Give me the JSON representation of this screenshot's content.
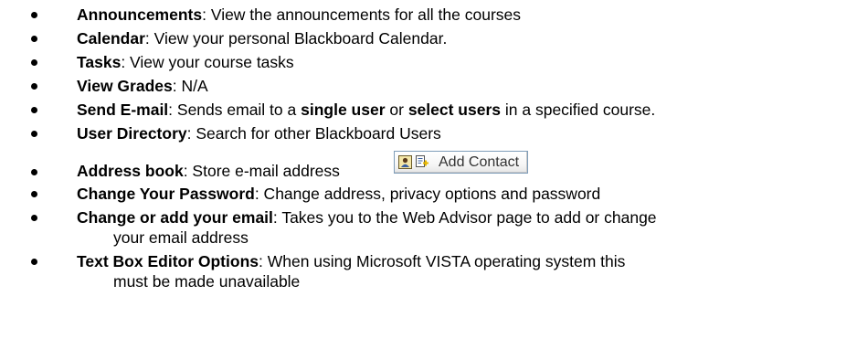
{
  "items": [
    {
      "term": "Announcements",
      "desc": ": View the announcements for all the courses"
    },
    {
      "term": "Calendar",
      "desc": ": View your personal Blackboard Calendar."
    },
    {
      "term": "Tasks",
      "desc": ": View your course tasks"
    },
    {
      "term": "View Grades",
      "desc": ": N/A"
    },
    {
      "term": "Send E-mail",
      "desc_a": ": Sends email to a ",
      "strong_1": "single user",
      "desc_b": " or ",
      "strong_2": "select users",
      "desc_c": " in a specified course."
    },
    {
      "term": "User Directory",
      "desc": ": Search for other Blackboard Users"
    },
    {
      "term": "Address book",
      "desc": ": Store e-mail address",
      "button_label": "Add Contact",
      "button_icons": [
        "contact-card-icon",
        "add-document-icon"
      ]
    },
    {
      "term": "Change Your Password",
      "desc": ": Change address, privacy options and password"
    },
    {
      "term": "Change or add your email",
      "desc": ": Takes you to the Web Advisor page to add or change",
      "desc_cont": "your email address"
    },
    {
      "term": "Text Box Editor Options",
      "desc": ": When using Microsoft VISTA operating system this",
      "desc_cont": "must be made unavailable"
    }
  ]
}
